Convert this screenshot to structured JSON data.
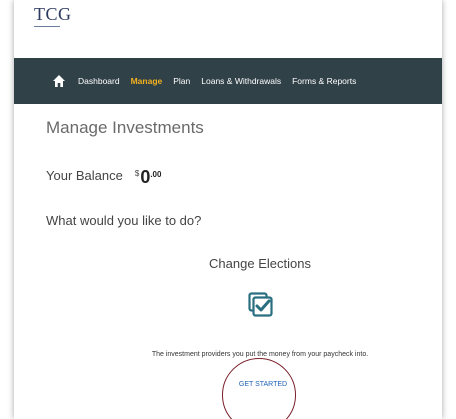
{
  "logo": {
    "text": "TCG",
    "subtext": ""
  },
  "nav": {
    "items": [
      {
        "label": "Dashboard",
        "active": false
      },
      {
        "label": "Manage",
        "active": true
      },
      {
        "label": "Plan",
        "active": false
      },
      {
        "label": "Loans & Withdrawals",
        "active": false
      },
      {
        "label": "Forms & Reports",
        "active": false
      }
    ],
    "background": "#314148",
    "active_color": "#f2b01e"
  },
  "page": {
    "title": "Manage Investments",
    "balance_label": "Your Balance",
    "balance_currency": "$",
    "balance_whole": "0",
    "balance_cents": ".00",
    "question": "What would you like to do?"
  },
  "action": {
    "title": "Change Elections",
    "icon": "checklist-icon",
    "description": "The investment providers you put the money from your paycheck into.",
    "cta_label": "GET STARTED",
    "icon_color": "#2a6f80",
    "cta_color": "#1e62b8"
  },
  "annotation": {
    "circle_color": "#7a1e2a"
  }
}
